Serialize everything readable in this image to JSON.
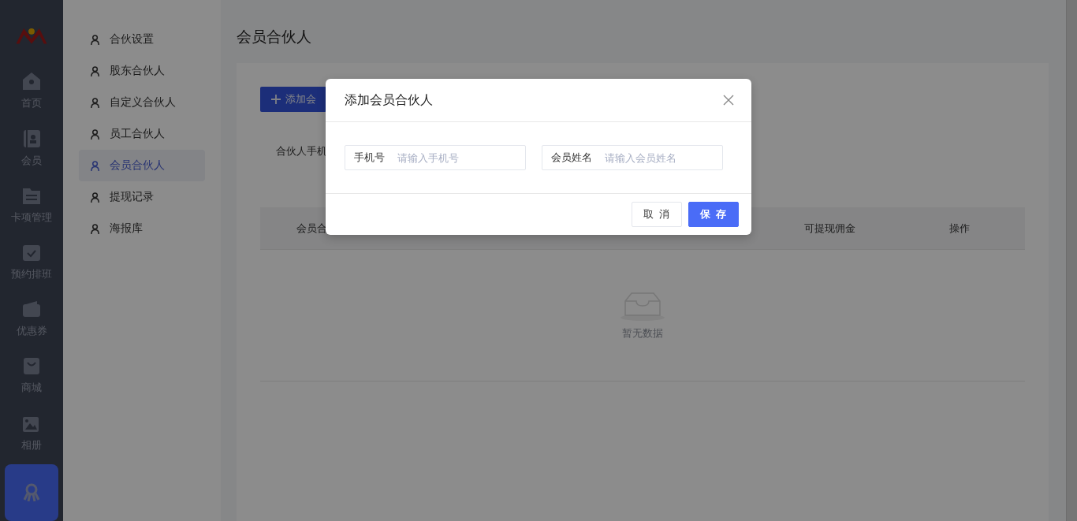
{
  "rail": {
    "items": [
      {
        "label": "首页",
        "selected": false
      },
      {
        "label": "会员",
        "selected": false
      },
      {
        "label": "卡项管理",
        "selected": false
      },
      {
        "label": "预约排班",
        "selected": false
      },
      {
        "label": "优惠券",
        "selected": false
      },
      {
        "label": "商城",
        "selected": false
      },
      {
        "label": "相册",
        "selected": false
      },
      {
        "selected": true
      }
    ]
  },
  "submenu": {
    "items": [
      {
        "label": "合伙设置",
        "selected": false
      },
      {
        "label": "股东合伙人",
        "selected": false
      },
      {
        "label": "自定义合伙人",
        "selected": false
      },
      {
        "label": "员工合伙人",
        "selected": false
      },
      {
        "label": "会员合伙人",
        "selected": true
      },
      {
        "label": "提现记录",
        "selected": false
      },
      {
        "label": "海报库",
        "selected": false
      }
    ]
  },
  "page": {
    "title": "会员合伙人",
    "add_button": "添加会",
    "filter_label": "合伙人手机",
    "table": {
      "columns": [
        "会员合",
        "可提现佣金",
        "操作"
      ],
      "empty_text": "暂无数据"
    }
  },
  "dialog": {
    "title": "添加会员合伙人",
    "fields": [
      {
        "label": "手机号",
        "placeholder": "请输入手机号"
      },
      {
        "label": "会员姓名",
        "placeholder": "请输入会员姓名"
      }
    ],
    "buttons": [
      {
        "label": "取 消",
        "kind": "default"
      },
      {
        "label": "保 存",
        "kind": "primary"
      }
    ]
  }
}
